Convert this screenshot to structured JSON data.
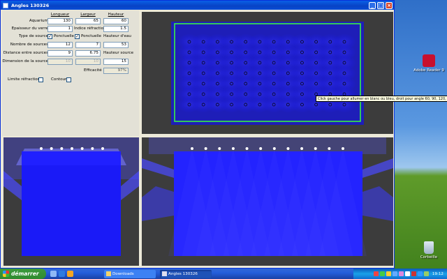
{
  "window": {
    "title": "Angles 130326",
    "minimize_glyph": "_",
    "maximize_glyph": "□",
    "close_glyph": "×"
  },
  "params": {
    "col_headers": {
      "longueur": "Longueur",
      "largeur": "Largeur",
      "hauteur": "Hauteur"
    },
    "aquarium": {
      "label": "Aquarium",
      "longueur": "130",
      "largeur": "65",
      "hauteur": "60"
    },
    "epaisseur": {
      "label": "Epaisseur du verre",
      "value": "1",
      "indice_label": "Indice réfraction",
      "indice": "1.5"
    },
    "type_source": {
      "label": "Type de source",
      "opt1": "Ponctuelle",
      "opt2": "Ponctuelle",
      "hauteur_eau_label": "Hauteur d'eau",
      "check1": "✓",
      "check2": "✓"
    },
    "nombre": {
      "label": "Nombre de sources",
      "longueur": "12",
      "largeur": "7",
      "hauteur": "53"
    },
    "distance": {
      "label": "Distance entre sources",
      "longueur": "9",
      "largeur": "6.75",
      "hauteur_source_label": "Hauteur source"
    },
    "dimension": {
      "label": "Dimension de la source",
      "longueur": "10",
      "largeur": "10",
      "hauteur": "15"
    },
    "efficacite": {
      "label": "Efficacité",
      "value": "97%"
    },
    "limite_label": "Limite réfraction",
    "contour_label": "Contour"
  },
  "tooltip": "Click gauche pour allumer en blanc ou bleu, droit pour angle 60, 90, 120, 150°",
  "desktop": {
    "icon1": "Adobe Reader 9",
    "recycle": "Corbeille"
  },
  "taskbar": {
    "start": "démarrer",
    "task1": "Downloads",
    "task2": "Angles 130326",
    "clock": "19:12"
  },
  "colors": {
    "beam": "#1a1aff",
    "frame": "#3cff3c",
    "panel_bg": "#3c3c3c"
  }
}
